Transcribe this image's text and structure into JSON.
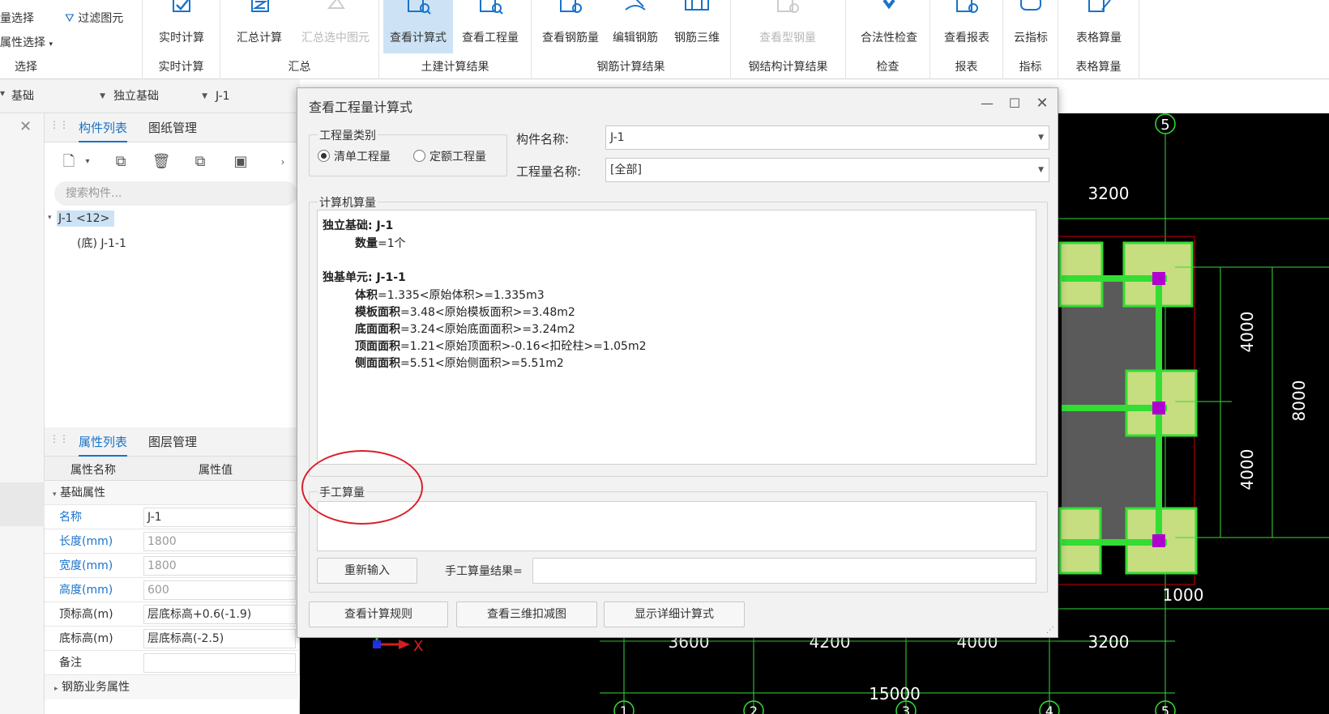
{
  "ribbon": {
    "select_group": {
      "item1": "量选择",
      "item2": "属性选择",
      "filter": "过滤图元",
      "label": "选择"
    },
    "realtime_group": {
      "btn": "实时计算",
      "label": "实时计算"
    },
    "summary_group": {
      "btn1": "汇总计算",
      "btn2": "汇总选中图元",
      "label": "汇总"
    },
    "civil_group": {
      "btn1": "查看计算式",
      "btn2": "查看工程量",
      "label": "土建计算结果"
    },
    "rebar_group": {
      "btn1": "查看钢筋量",
      "btn2": "编辑钢筋",
      "btn3": "钢筋三维",
      "label": "钢筋计算结果"
    },
    "steel_group": {
      "btn1": "查看型钢量",
      "label": "钢结构计算结果"
    },
    "check_group": {
      "btn1": "合法性检查",
      "label": "检查"
    },
    "report_group": {
      "btn1": "查看报表",
      "label": "报表"
    },
    "index_group": {
      "btn1": "云指标",
      "label": "指标"
    },
    "table_group": {
      "btn1": "表格算量",
      "label": "表格算量"
    }
  },
  "toolbar2": {
    "combo1": "基础",
    "combo2": "独立基础",
    "combo3": "J-1"
  },
  "complist": {
    "tab_active": "构件列表",
    "tab_other": "图纸管理",
    "search_placeholder": "搜索构件...",
    "tree_root": "J-1 <12>",
    "tree_child": "(底) J-1-1"
  },
  "proplist": {
    "tab_active": "属性列表",
    "tab_other": "图层管理",
    "col_name": "属性名称",
    "col_value": "属性值",
    "section": "基础属性",
    "rows": [
      {
        "k": "名称",
        "v": "J-1"
      },
      {
        "k": "长度(mm)",
        "v": "1800"
      },
      {
        "k": "宽度(mm)",
        "v": "1800"
      },
      {
        "k": "高度(mm)",
        "v": "600"
      },
      {
        "k": "顶标高(m)",
        "v": "层底标高+0.6(-1.9)"
      },
      {
        "k": "底标高(m)",
        "v": "层底标高(-2.5)"
      },
      {
        "k": "备注",
        "v": ""
      }
    ],
    "section2": "钢筋业务属性"
  },
  "dialog": {
    "title": "查看工程量计算式",
    "qty_type_legend": "工程量类别",
    "radio1": "清单工程量",
    "radio2": "定额工程量",
    "comp_name_label": "构件名称:",
    "comp_name_value": "J-1",
    "qty_name_label": "工程量名称:",
    "qty_name_value": "[全部]",
    "calc_legend": "计算机算量",
    "calc": {
      "l1": "独立基础: J-1",
      "l2k": "数量",
      "l2v": "=1个",
      "l3": "独基单元: J-1-1",
      "l4k": "体积",
      "l4v": "=1.335<原始体积>=1.335m3",
      "l5k": "模板面积",
      "l5v": "=3.48<原始模板面积>=3.48m2",
      "l6k": "底面面积",
      "l6v": "=3.24<原始底面面积>=3.24m2",
      "l7k": "顶面面积",
      "l7v": "=1.21<原始顶面积>-0.16<扣砼柱>=1.05m2",
      "l8k": "侧面面积",
      "l8v": "=5.51<原始侧面积>=5.51m2"
    },
    "manual_legend": "手工算量",
    "reinput_btn": "重新输入",
    "manual_result_label": "手工算量结果=",
    "btn_rules": "查看计算规则",
    "btn_3d": "查看三维扣减图",
    "btn_detail": "显示详细计算式"
  },
  "canvas": {
    "axis_top": "5",
    "dim_top": "3200",
    "dim_right1": "4000",
    "dim_right2": "4000",
    "dim_right_total": "8000",
    "dim_1000": "1000",
    "dims_bottom": [
      "3600",
      "4200",
      "4000",
      "3200"
    ],
    "dim_total": "15000",
    "axis_x_label": "X",
    "axes_bottom": [
      "1",
      "2",
      "3",
      "4",
      "5"
    ]
  },
  "colors": {
    "accent": "#1a73c9",
    "highlight": "#d9202a",
    "green": "#33dd33",
    "footing_fill": "#c6dd80"
  }
}
